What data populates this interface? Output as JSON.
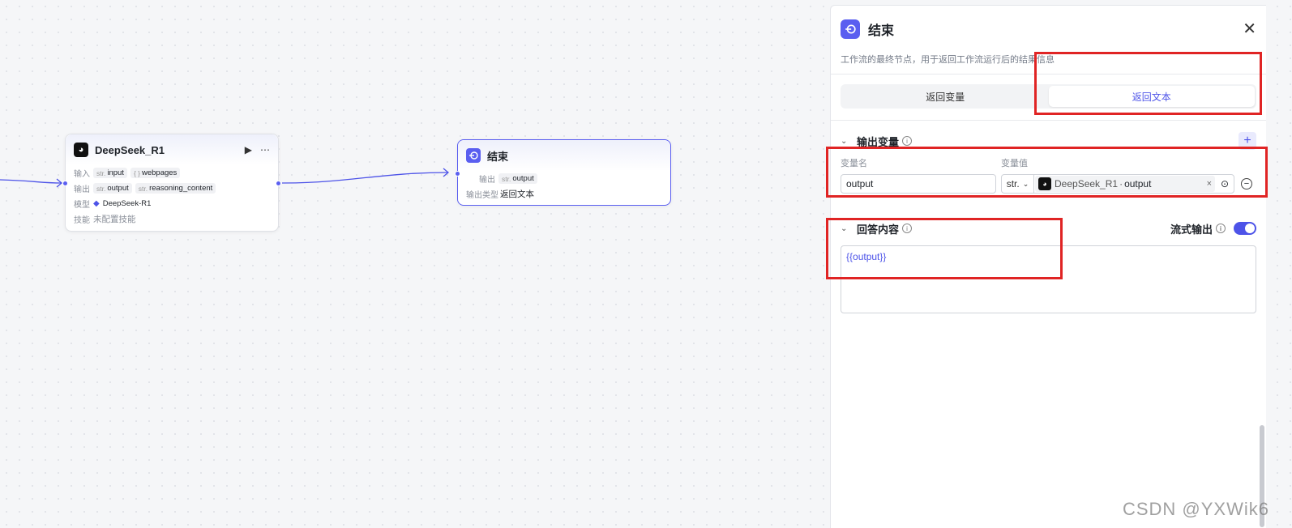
{
  "canvas": {
    "nodes": {
      "deepseek": {
        "title": "DeepSeek_R1",
        "input_label": "输入",
        "inputs": [
          {
            "type": "str.",
            "name": "input"
          },
          {
            "type": "{ }",
            "name": "webpages"
          }
        ],
        "output_label": "输出",
        "outputs": [
          {
            "type": "str.",
            "name": "output"
          },
          {
            "type": "str.",
            "name": "reasoning_content"
          }
        ],
        "model_label": "模型",
        "model": "DeepSeek-R1",
        "skill_label": "技能",
        "skill": "未配置技能"
      },
      "end": {
        "title": "结束",
        "output_label": "输出",
        "output": {
          "type": "str.",
          "name": "output"
        },
        "output_type_label": "输出类型",
        "output_type": "返回文本"
      }
    }
  },
  "panel": {
    "title": "结束",
    "description": "工作流的最终节点，用于返回工作流运行后的结果信息",
    "tabs": [
      {
        "label": "返回变量"
      },
      {
        "label": "返回文本",
        "active": true
      }
    ],
    "output_vars": {
      "title": "输出变量",
      "col_name": "变量名",
      "col_value": "变量值",
      "row": {
        "name": "output",
        "type": "str.",
        "ref_node": "DeepSeek_R1",
        "ref_sep": "·",
        "ref_var": "output"
      }
    },
    "answer": {
      "title": "回答内容",
      "stream_label": "流式输出",
      "stream_on": true,
      "content": "{{output}}"
    }
  },
  "watermark": "CSDN @YXWik6",
  "colors": {
    "accent": "#4d53e8",
    "highlight": "#e02424"
  }
}
